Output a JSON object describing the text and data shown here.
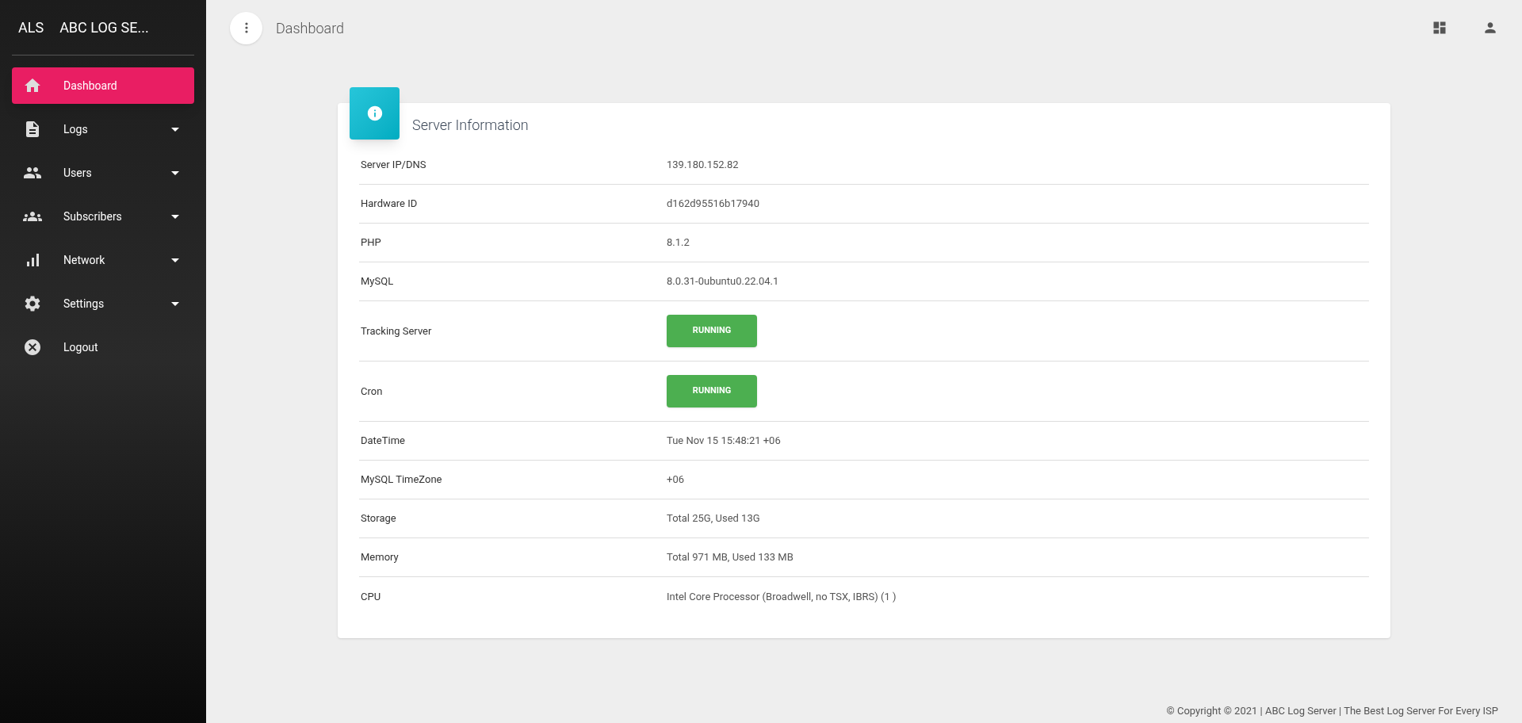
{
  "sidebar": {
    "logo_short": "ALS",
    "logo_text": "ABC LOG SE...",
    "items": [
      {
        "label": "Dashboard",
        "selected": true,
        "has_caret": false
      },
      {
        "label": "Logs",
        "selected": false,
        "has_caret": true
      },
      {
        "label": "Users",
        "selected": false,
        "has_caret": true
      },
      {
        "label": "Subscribers",
        "selected": false,
        "has_caret": true
      },
      {
        "label": "Network",
        "selected": false,
        "has_caret": true
      },
      {
        "label": "Settings",
        "selected": false,
        "has_caret": true
      },
      {
        "label": "Logout",
        "selected": false,
        "has_caret": false
      }
    ]
  },
  "topbar": {
    "title": "Dashboard"
  },
  "card": {
    "title": "Server Information",
    "rows": [
      {
        "kind": "text",
        "label": "Server IP/DNS",
        "value": "139.180.152.82"
      },
      {
        "kind": "text",
        "label": "Hardware ID",
        "value": "d162d95516b17940"
      },
      {
        "kind": "text",
        "label": "PHP",
        "value": "8.1.2"
      },
      {
        "kind": "text",
        "label": "MySQL",
        "value": "8.0.31-0ubuntu0.22.04.1"
      },
      {
        "kind": "status",
        "label": "Tracking Server",
        "value": "RUNNING"
      },
      {
        "kind": "status",
        "label": "Cron",
        "value": "RUNNING"
      },
      {
        "kind": "text",
        "label": "DateTime",
        "value": "Tue Nov 15 15:48:21 +06"
      },
      {
        "kind": "text",
        "label": "MySQL TimeZone",
        "value": "+06"
      },
      {
        "kind": "text",
        "label": "Storage",
        "value": "Total 25G, Used 13G"
      },
      {
        "kind": "text",
        "label": "Memory",
        "value": "Total 971 MB, Used 133 MB"
      },
      {
        "kind": "text",
        "label": "CPU",
        "value": "Intel Core Processor (Broadwell, no TSX, IBRS) (1 )"
      }
    ]
  },
  "footer": "© Copyright © 2021 | ABC Log Server | The Best Log Server For Every ISP"
}
